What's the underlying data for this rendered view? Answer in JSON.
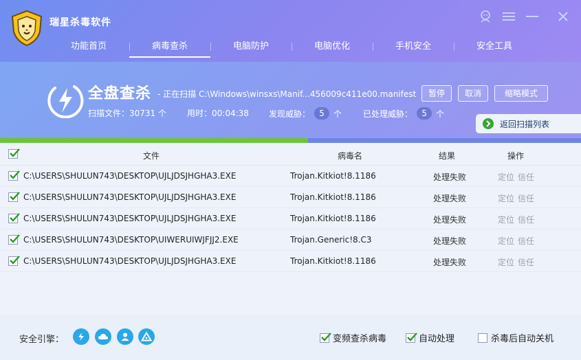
{
  "app": {
    "title": "瑞星杀毒软件"
  },
  "nav": [
    {
      "label": "功能首页"
    },
    {
      "label": "病毒查杀",
      "active": true
    },
    {
      "label": "电脑防护"
    },
    {
      "label": "电脑优化"
    },
    {
      "label": "手机安全"
    },
    {
      "label": "安全工具"
    }
  ],
  "status": {
    "title": "全盘查杀",
    "path": "- 正在扫描 C:\\Windows\\winsxs\\Manif...456009c411e00.manifest",
    "buttons": {
      "pause": "暂停",
      "cancel": "取消",
      "mini": "缩略模式"
    },
    "scanned_label": "扫描文件：30731 个",
    "time_label": "用时：00:04:38",
    "threats_label": "发现威胁：",
    "threats_count": "5",
    "handled_label": "已处理威胁：",
    "handled_count": "5",
    "unit": "个",
    "back_label": "返回扫描列表",
    "progress": 0.53
  },
  "table": {
    "headers": {
      "file": "文件",
      "virus": "病毒名",
      "result": "结果",
      "action": "操作"
    },
    "rows": [
      {
        "path": "C:\\USERS\\SHULUN743\\DESKTOP\\UJLJDSJHGHA3.EXE",
        "virus": "Trojan.Kitkiot!8.1186",
        "result": "处理失败",
        "locate": "定位",
        "trust": "信任"
      },
      {
        "path": "C:\\USERS\\SHULUN743\\DESKTOP\\UJLJDSJHGHA3.EXE",
        "virus": "Trojan.Kitkiot!8.1186",
        "result": "处理失败",
        "locate": "定位",
        "trust": "信任"
      },
      {
        "path": "C:\\USERS\\SHULUN743\\DESKTOP\\UJLJDSJHGHA3.EXE",
        "virus": "Trojan.Kitkiot!8.1186",
        "result": "处理失败",
        "locate": "定位",
        "trust": "信任"
      },
      {
        "path": "C:\\USERS\\SHULUN743\\DESKTOP\\UIWERUIWJFJJ2.EXE",
        "virus": "Trojan.Generic!8.C3",
        "result": "处理失败",
        "locate": "定位",
        "trust": "信任"
      },
      {
        "path": "C:\\USERS\\SHULUN743\\DESKTOP\\UJLJDSJHGHA3.EXE",
        "virus": "Trojan.Kitkiot!8.1186",
        "result": "处理失败",
        "locate": "定位",
        "trust": "信任"
      }
    ]
  },
  "footer": {
    "engine_label": "安全引擎：",
    "engines": [
      "lightning-icon",
      "cloud-icon",
      "user-icon",
      "triangle-icon"
    ],
    "options": [
      {
        "label": "变频查杀病毒",
        "checked": true
      },
      {
        "label": "自动处理",
        "checked": true
      },
      {
        "label": "杀毒后自动关机",
        "checked": false
      }
    ]
  },
  "colors": {
    "accent_green": "#38a535",
    "header_blue": "#6e8ff0",
    "engine_blue": "#2aa7e8"
  }
}
